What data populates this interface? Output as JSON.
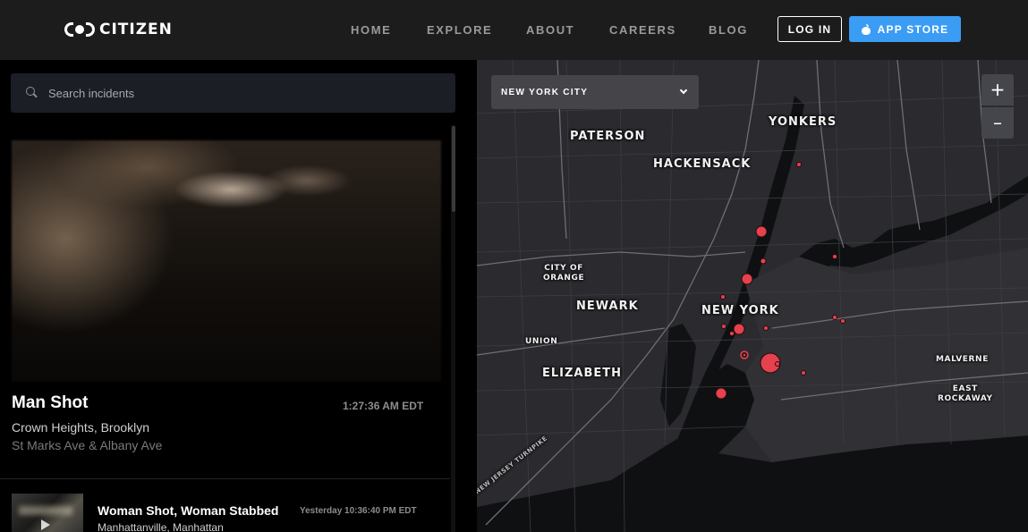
{
  "header": {
    "logo_text": "CITIZEN",
    "nav": [
      {
        "label": "HOME"
      },
      {
        "label": "EXPLORE"
      },
      {
        "label": "ABOUT"
      },
      {
        "label": "CAREERS"
      },
      {
        "label": "BLOG"
      }
    ],
    "login_label": "LOG IN",
    "store_label": "APP STORE",
    "accent_color": "#3b9cf4"
  },
  "search": {
    "placeholder": "Search incidents",
    "icon": "search-icon"
  },
  "incidents": {
    "featured": {
      "title": "Man Shot",
      "time": "1:27:36 AM EDT",
      "location": "Crown Heights, Brooklyn",
      "street": "St Marks Ave & Albany Ave"
    },
    "items": [
      {
        "title": "Woman Shot, Woman Stabbed",
        "time": "Yesterday 10:36:40 PM EDT",
        "location": "Manhattanville, Manhattan"
      }
    ]
  },
  "map": {
    "city_select": "NEW YORK CITY",
    "zoom_in": "+",
    "zoom_out": "–",
    "incident_color": "#e5424d",
    "labels": {
      "yonkers": "YONKERS",
      "paterson": "PATERSON",
      "hackensack": "HACKENSACK",
      "city_of_orange_1": "CITY OF",
      "city_of_orange_2": "ORANGE",
      "newark": "NEWARK",
      "new_york": "NEW YORK",
      "union": "UNION",
      "elizabeth": "ELIZABETH",
      "malverne": "MALVERNE",
      "east_rockaway_1": "EAST",
      "east_rockaway_2": "ROCKAWAY",
      "turnpike": "NEW JERSEY TURNPIKE"
    }
  }
}
